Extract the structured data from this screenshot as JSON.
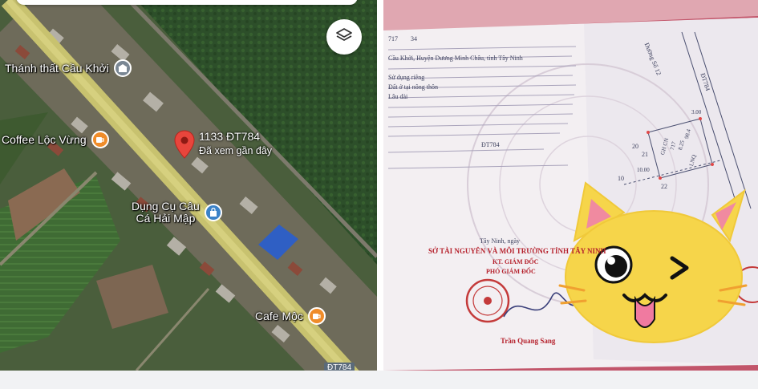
{
  "map": {
    "pois": [
      {
        "name": "Thánh thất Cầu Khởi",
        "icon": "temple-icon"
      },
      {
        "name": "Coffee Lộc Vừng",
        "icon": "coffee-cup-icon"
      },
      {
        "name": "Dụng Cụ Câu Cá Hải Mập",
        "name_line1": "Dụng Cụ Câu",
        "name_line2": "Cá Hải Mập",
        "icon": "shopping-bag-icon"
      },
      {
        "name": "Cafe Mộc",
        "icon": "coffee-cup-icon"
      }
    ],
    "pin": {
      "address": "1133 ĐT784",
      "note": "Đã xem gần đây",
      "icon": "map-pin-icon",
      "color": "#e8453c"
    },
    "layers_button_icon": "layers-icon",
    "road_shield": "ĐT784",
    "colors": {
      "road": "#c8c26f",
      "forest": "#2d4f2a",
      "poi_orange": "#ef8c2a",
      "poi_blue": "#3b82c8"
    }
  },
  "document": {
    "lines": [
      "717",
      "34",
      "Cầu Khởi, Huyện Dương Minh Châu, tỉnh Tây Ninh",
      "Sử dụng riêng",
      "Đất ở tại nông thôn",
      "Lâu dài",
      "ĐT784",
      "Tây Ninh, ngày",
      "SỞ TÀI NGUYÊN VÀ MÔI TRƯỜNG TỈNH TÂY NINH",
      "KT. GIÁM ĐỐC",
      "PHÓ GIÁM ĐỐC",
      "Trần Quang Sang"
    ],
    "plot_labels": [
      "Đường Số 12",
      "ĐT784",
      "20",
      "21",
      "22",
      "10",
      "10.00",
      "3.00",
      "GH CN",
      "LNQ",
      "717",
      "8.25",
      "98.4"
    ],
    "sticker": "cat-face-sticker",
    "colors": {
      "stamp": "#c43a3a",
      "ink": "#3b3f5c",
      "pink_border": "#c2556a"
    }
  }
}
